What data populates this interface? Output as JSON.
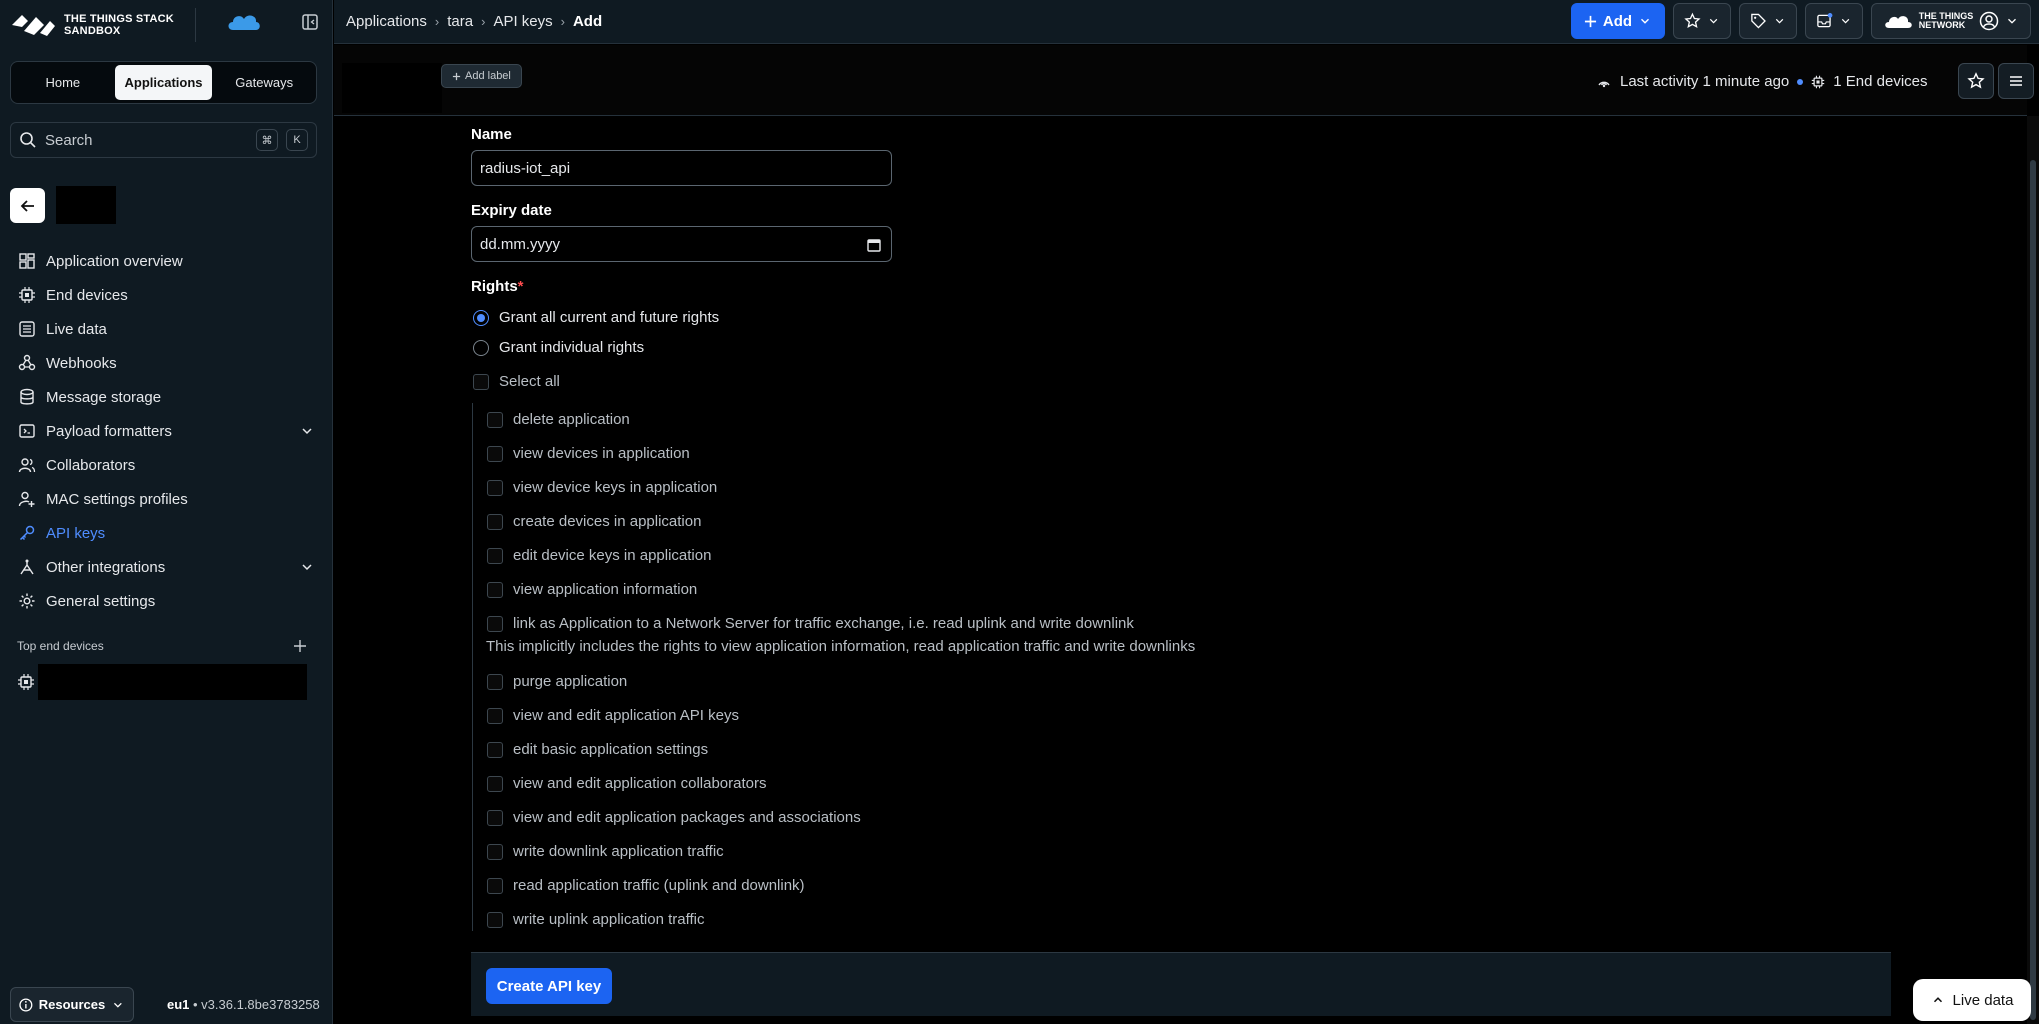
{
  "brand": {
    "name_line1": "THE THINGS STACK",
    "name_line2": "SANDBOX",
    "network_line1": "THE THINGS",
    "network_line2": "NETWORK",
    "accent": "#1c64f2",
    "active_nav": "#4f8dff"
  },
  "top_tabs": [
    {
      "label": "Home",
      "active": false
    },
    {
      "label": "Applications",
      "active": true
    },
    {
      "label": "Gateways",
      "active": false
    }
  ],
  "search": {
    "placeholder": "Search",
    "kbd1": "⌘",
    "kbd2": "K"
  },
  "nav": {
    "items": [
      {
        "label": "Application overview",
        "icon": "overview-icon"
      },
      {
        "label": "End devices",
        "icon": "chip-icon"
      },
      {
        "label": "Live data",
        "icon": "list-icon"
      },
      {
        "label": "Webhooks",
        "icon": "webhook-icon"
      },
      {
        "label": "Message storage",
        "icon": "database-icon"
      },
      {
        "label": "Payload formatters",
        "icon": "code-icon",
        "expandable": true
      },
      {
        "label": "Collaborators",
        "icon": "users-icon"
      },
      {
        "label": "MAC settings profiles",
        "icon": "user-settings-icon"
      },
      {
        "label": "API keys",
        "icon": "key-icon",
        "active": true
      },
      {
        "label": "Other integrations",
        "icon": "integrations-icon",
        "expandable": true
      },
      {
        "label": "General settings",
        "icon": "gear-icon"
      }
    ]
  },
  "top_end_devices": {
    "label": "Top end devices"
  },
  "footer": {
    "resources": "Resources",
    "region": "eu1",
    "version": " • v3.36.1.8be3783258"
  },
  "header": {
    "breadcrumb": [
      "Applications",
      "tara",
      "API keys",
      "Add"
    ],
    "add_label": "Add"
  },
  "subheader": {
    "add_label": "Add label",
    "last_activity": "Last activity 1 minute ago",
    "end_devices": "1 End devices"
  },
  "form": {
    "name_label": "Name",
    "name_value": "radius-iot_api",
    "expiry_label": "Expiry date",
    "expiry_placeholder": "dd.mm.yyyy",
    "rights_label": "Rights",
    "required_mark": "*",
    "grant_all": "Grant all current and future rights",
    "grant_individual": "Grant individual rights",
    "select_all": "Select all",
    "rights": [
      "delete application",
      "view devices in application",
      "view device keys in application",
      "create devices in application",
      "edit device keys in application",
      "view application information",
      "link as Application to a Network Server for traffic exchange, i.e. read uplink and write downlink",
      "purge application",
      "view and edit application API keys",
      "edit basic application settings",
      "view and edit application collaborators",
      "view and edit application packages and associations",
      "write downlink application traffic",
      "read application traffic (uplink and downlink)",
      "write uplink application traffic"
    ],
    "link_hint": "This implicitly includes the rights to view application information, read application traffic and write downlinks",
    "submit": "Create API key"
  },
  "live_data": "Live data"
}
